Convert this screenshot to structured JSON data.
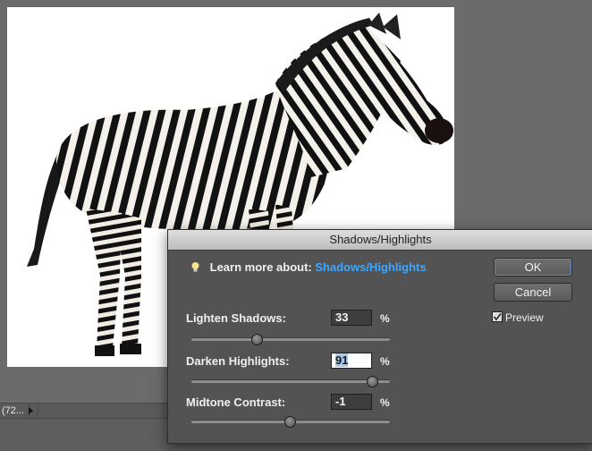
{
  "status_bar": {
    "zoom": "(72..."
  },
  "dialog": {
    "title": "Shadows/Highlights",
    "learn_more_label": "Learn more about:",
    "learn_more_link": "Shadows/Highlights",
    "ok_label": "OK",
    "cancel_label": "Cancel",
    "preview_label": "Preview",
    "preview_checked": true,
    "params": [
      {
        "label": "Lighten Shadows:",
        "value": "33",
        "unit": "%",
        "slider_fraction": 0.33
      },
      {
        "label": "Darken Highlights:",
        "value": "91",
        "unit": "%",
        "slider_fraction": 0.91
      },
      {
        "label": "Midtone Contrast:",
        "value": "-1",
        "unit": "%",
        "slider_fraction": 0.495
      }
    ]
  },
  "icons": [
    "lightbulb-icon",
    "checkmark-icon",
    "play-triangle-icon"
  ],
  "colors": {
    "link": "#3fa6ff",
    "dialog_bg": "#535353",
    "workspace_bg": "#6b6b6b"
  }
}
